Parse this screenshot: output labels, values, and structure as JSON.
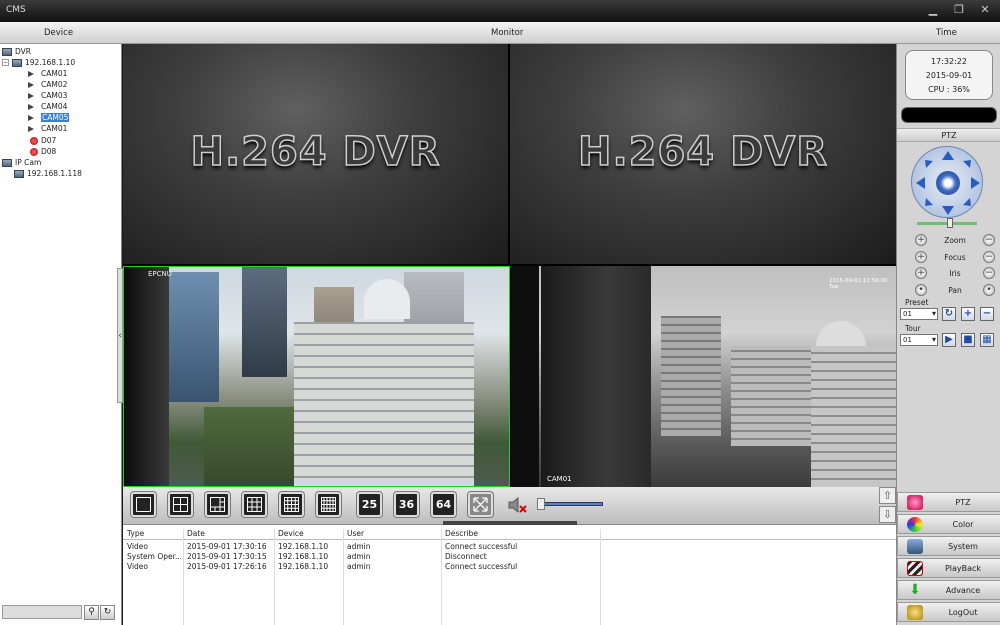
{
  "window": {
    "title": "CMS"
  },
  "header": {
    "device": "Device",
    "monitor": "Monitor",
    "time": "Time"
  },
  "tree": {
    "dvr_root": "DVR",
    "dvr_host": "192.168.1.10",
    "channels": [
      "CAM01",
      "CAM02",
      "CAM03",
      "CAM04",
      "CAM05",
      "CAM01",
      "D07",
      "D08"
    ],
    "selected_channel": "CAM05",
    "ipcam_root": "IP Cam",
    "ipcam_host": "192.168.1.118"
  },
  "monitor": {
    "tile1_text": "H.264 DVR",
    "tile2_text": "H.264 DVR",
    "tile3_osd": "EPCNU",
    "tile4_osd_time": "2015-09-01 12:56:00 Tue",
    "tile4_label": "CAM01"
  },
  "toolbar": {
    "layout_25": "25",
    "layout_36": "36",
    "layout_64": "64"
  },
  "log": {
    "headers": [
      "Type",
      "Date",
      "Device",
      "User",
      "Describe"
    ],
    "rows": [
      [
        "Video",
        "2015-09-01 17:30:16",
        "192.168.1.10",
        "admin",
        "Connect successful"
      ],
      [
        "System Oper...",
        "2015-09-01 17:30:15",
        "192.168.1.10",
        "admin",
        "Disconnect"
      ],
      [
        "Video",
        "2015-09-01 17:26:16",
        "192.168.1.10",
        "admin",
        "Connect successful"
      ]
    ]
  },
  "clock": {
    "time": "17:32:22",
    "date": "2015-09-01",
    "cpu": "CPU : 36%"
  },
  "ptz": {
    "title": "PTZ",
    "zoom": "Zoom",
    "focus": "Focus",
    "iris": "Iris",
    "pan": "Pan",
    "preset_label": "Preset",
    "preset_value": "01",
    "tour_label": "Tour",
    "tour_value": "01"
  },
  "menu": {
    "ptz": "PTZ",
    "color": "Color",
    "system": "System",
    "playback": "PlayBack",
    "advance": "Advance",
    "logout": "LogOut"
  }
}
